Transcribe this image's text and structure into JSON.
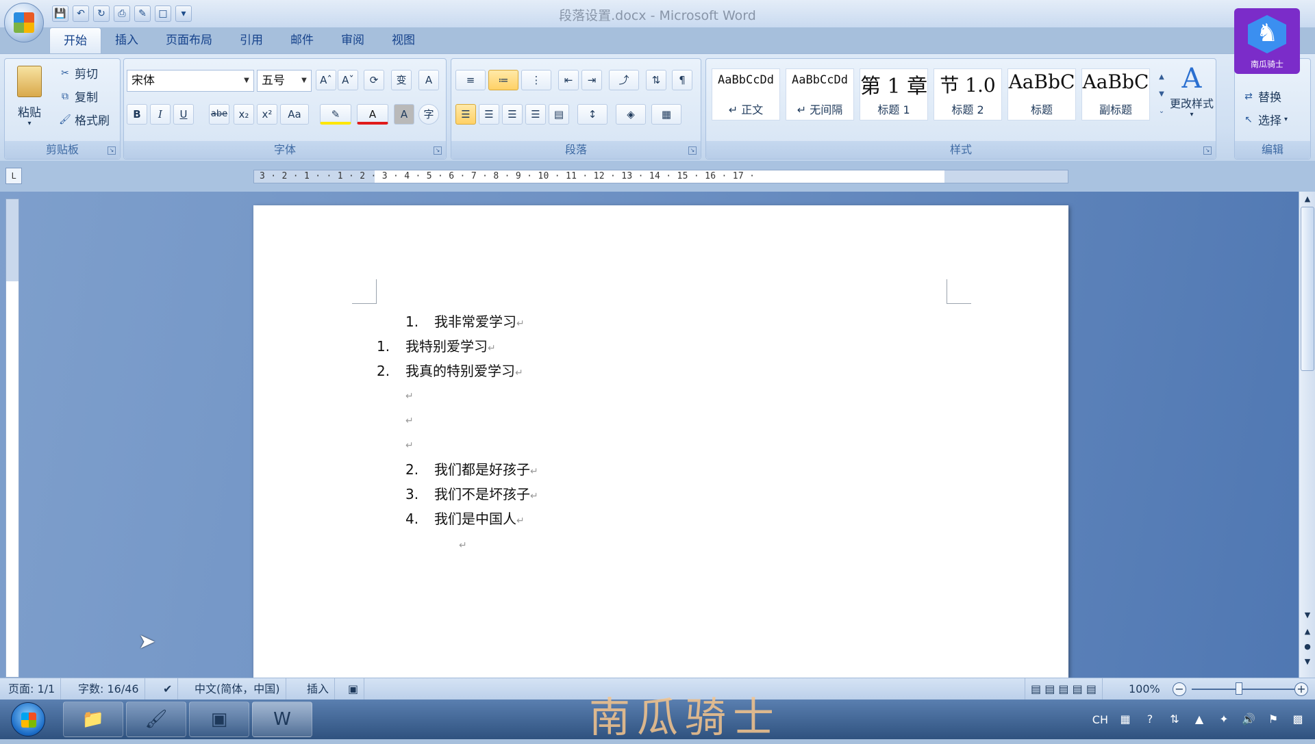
{
  "window": {
    "title": "段落设置.docx - Microsoft Word"
  },
  "tabs": [
    {
      "label": "开始"
    },
    {
      "label": "插入"
    },
    {
      "label": "页面布局"
    },
    {
      "label": "引用"
    },
    {
      "label": "邮件"
    },
    {
      "label": "审阅"
    },
    {
      "label": "视图"
    }
  ],
  "ribbon": {
    "clipboard": {
      "label": "剪贴板",
      "paste": "粘贴",
      "cut": "剪切",
      "copy": "复制",
      "format_painter": "格式刷"
    },
    "font": {
      "label": "字体",
      "font_name": "宋体",
      "font_size": "五号",
      "bold": "B",
      "italic": "I",
      "underline": "U",
      "strike": "abe",
      "sub": "x₂",
      "sup": "x²",
      "case": "Aa"
    },
    "paragraph": {
      "label": "段落"
    },
    "styles": {
      "label": "样式",
      "items": [
        {
          "sample": "AaBbCcDd",
          "name": "↵ 正文"
        },
        {
          "sample": "AaBbCcDd",
          "name": "↵ 无间隔"
        },
        {
          "sample": "第 1 章",
          "name": "标题 1"
        },
        {
          "sample": "节 1.0",
          "name": "标题 2"
        },
        {
          "sample": "AaBbC",
          "name": "标题"
        },
        {
          "sample": "AaBbC",
          "name": "副标题"
        }
      ],
      "change_styles": "更改样式"
    },
    "editing": {
      "label": "编辑",
      "replace": "替换",
      "select": "选择"
    }
  },
  "ruler": {
    "numbers": "3 · 2 · 1 ·   · 1 · 2 · 3 · 4 · 5 · 6 · 7 · 8 · 9 · 10 · 11 · 12 · 13 · 14 · 15 · 16 · 17 ·"
  },
  "document": {
    "lines": [
      {
        "num": "1.",
        "text": "我非常爱学习",
        "mark": "↵"
      },
      {
        "num": "1.",
        "text": "我特别爱学习",
        "mark": "↵"
      },
      {
        "num": "2.",
        "text": "我真的特别爱学习",
        "mark": "↵"
      },
      {
        "num": "",
        "text": "",
        "mark": "↵"
      },
      {
        "num": "",
        "text": "",
        "mark": "↵"
      },
      {
        "num": "",
        "text": "",
        "mark": "↵"
      },
      {
        "num": "2.",
        "text": "我们都是好孩子",
        "mark": "↵"
      },
      {
        "num": "3.",
        "text": "我们不是坏孩子",
        "mark": "↵"
      },
      {
        "num": "4.",
        "text": "我们是中国人",
        "mark": "↵"
      },
      {
        "num": "",
        "text": "",
        "mark": "↵"
      }
    ]
  },
  "status": {
    "page": "页面: 1/1",
    "words": "字数: 16/46",
    "language": "中文(简体，中国)",
    "mode": "插入",
    "zoom": "100%"
  },
  "watermark": {
    "badge_label": "南瓜骑士",
    "text": "南瓜骑士"
  },
  "tray": {
    "lang": "CH"
  },
  "colors": {
    "ribbon": "#dde9f7",
    "workspace": "#6f92c4",
    "accent": "#15428b"
  }
}
